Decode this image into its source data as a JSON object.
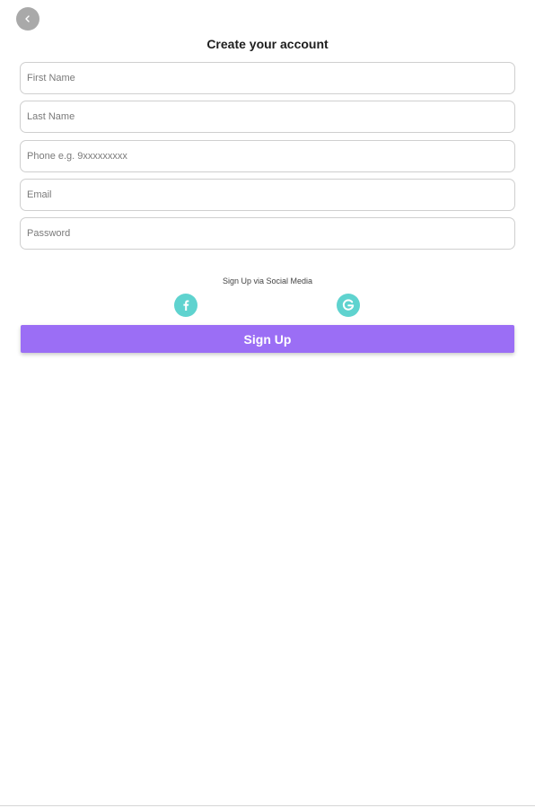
{
  "header": {
    "back_icon": "chevron-left-icon",
    "title": "Create your account"
  },
  "form": {
    "first_name": {
      "placeholder": "First Name",
      "value": ""
    },
    "last_name": {
      "placeholder": "Last Name",
      "value": ""
    },
    "phone": {
      "placeholder": "Phone e.g. 9xxxxxxxxx",
      "value": ""
    },
    "email": {
      "placeholder": "Email",
      "value": ""
    },
    "password": {
      "placeholder": "Password",
      "value": ""
    }
  },
  "social": {
    "caption": "Sign Up via Social Media",
    "facebook_icon": "facebook-icon",
    "google_icon": "google-icon",
    "icon_color": "#5fd3cf"
  },
  "actions": {
    "signup_label": "Sign Up",
    "signup_color": "#9b6ef5"
  }
}
